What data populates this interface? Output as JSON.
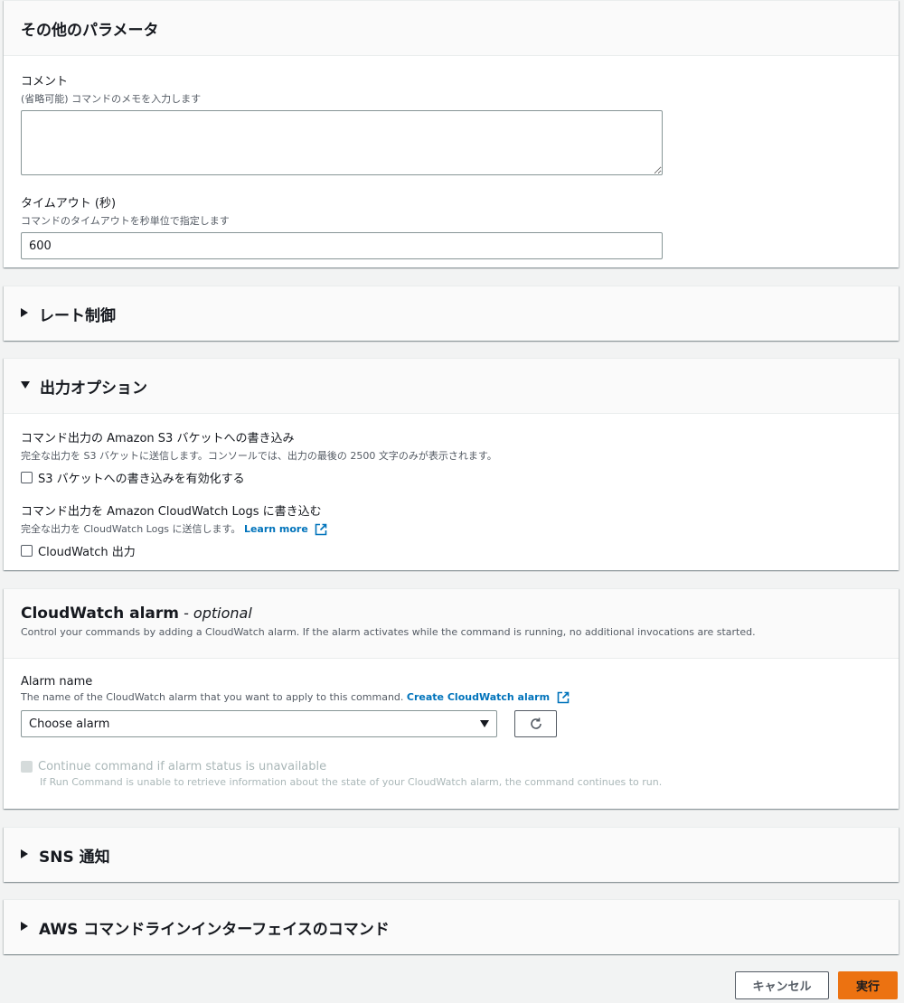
{
  "other_params": {
    "title": "その他のパラメータ",
    "comment": {
      "label": "コメント",
      "description": "(省略可能) コマンドのメモを入力します",
      "value": ""
    },
    "timeout": {
      "label": "タイムアウト (秒)",
      "description": "コマンドのタイムアウトを秒単位で指定します",
      "value": "600"
    }
  },
  "rate_control": {
    "title": "レート制御"
  },
  "output_options": {
    "title": "出力オプション",
    "s3": {
      "label": "コマンド出力の Amazon S3 バケットへの書き込み",
      "description": "完全な出力を S3 バケットに送信します。コンソールでは、出力の最後の 2500 文字のみが表示されます。",
      "checkbox_label": "S3 バケットへの書き込みを有効化する",
      "checked": false
    },
    "cloudwatch": {
      "label": "コマンド出力を Amazon CloudWatch Logs に書き込む",
      "description": "完全な出力を CloudWatch Logs に送信します。",
      "link": "Learn more",
      "checkbox_label": "CloudWatch 出力",
      "checked": false
    }
  },
  "alarm": {
    "title": "CloudWatch alarm",
    "title_suffix": "- optional",
    "description": "Control your commands by adding a CloudWatch alarm. If the alarm activates while the command is running, no additional invocations are started.",
    "name_label": "Alarm name",
    "name_description": "The name of the CloudWatch alarm that you want to apply to this command.",
    "create_link": "Create CloudWatch alarm",
    "select_value": "Choose alarm",
    "continue_label": "Continue command if alarm status is unavailable",
    "continue_description": "If Run Command is unable to retrieve information about the state of your CloudWatch alarm, the command continues to run.",
    "continue_disabled": true
  },
  "sns": {
    "title": "SNS 通知"
  },
  "cli": {
    "title": "AWS コマンドラインインターフェイスのコマンド"
  },
  "footer": {
    "cancel_label": "キャンセル",
    "run_label": "実行"
  },
  "colors": {
    "link": "#0073bb",
    "primary": "#ec7211",
    "background": "#f2f3f3"
  },
  "icons": [
    "caret-right-icon",
    "caret-down-icon",
    "external-link-icon",
    "refresh-icon",
    "dropdown-caret-icon"
  ]
}
